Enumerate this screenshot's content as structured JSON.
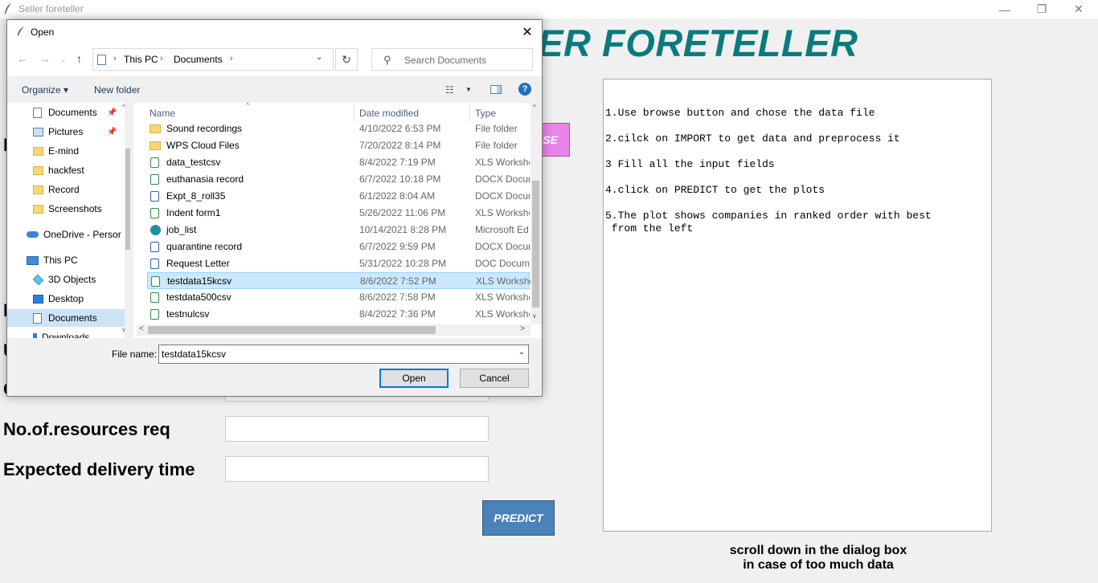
{
  "app": {
    "title": "Seller foreteller",
    "heading": "LER FORETELLER",
    "browse_label": "SE",
    "predict_label": "PREDICT",
    "window_buttons": {
      "minimize": "—",
      "maximize": "❐",
      "close": "✕"
    }
  },
  "form": {
    "partial_labels": [
      "I",
      "I",
      "U",
      "C"
    ],
    "labels": {
      "resources": "No.of.resources req",
      "delivery": "Expected delivery time"
    }
  },
  "instructions": [
    "1.Use browse button and chose the data file",
    "2.cilck on IMPORT to get data and preprocess it",
    "3 Fill all the input fields",
    "4.click on PREDICT to get the plots",
    "5.The plot shows companies in ranked order with best",
    " from the left"
  ],
  "note": [
    "scroll down in the dialog box",
    "in case of too much data"
  ],
  "dialog": {
    "title": "Open",
    "close_glyph": "✕",
    "nav": {
      "back": "←",
      "forward": "→",
      "recent": "⌄",
      "up": "↑",
      "refresh": "↻",
      "dropdown": "⌄"
    },
    "breadcrumb": [
      "This PC",
      "Documents"
    ],
    "breadcrumb_sep": "›",
    "search_placeholder": "Search Documents",
    "search_glyph": "⚲",
    "toolbar": {
      "organize": "Organize ▾",
      "new_folder": "New folder",
      "view_glyph": "☷",
      "view_dd": "▼",
      "help": "?"
    },
    "nav_pane": [
      {
        "label": "Documents",
        "icon": "doc",
        "pinned": true
      },
      {
        "label": "Pictures",
        "icon": "pic",
        "pinned": true
      },
      {
        "label": "E-mind",
        "icon": "folder",
        "pinned": false
      },
      {
        "label": "hackfest",
        "icon": "folder",
        "pinned": false
      },
      {
        "label": "Record",
        "icon": "folder",
        "pinned": false
      },
      {
        "label": "Screenshots",
        "icon": "folder",
        "pinned": false
      },
      {
        "label": "OneDrive - Persor",
        "icon": "cloud",
        "pinned": false
      },
      {
        "label": "This PC",
        "icon": "pc",
        "pinned": false
      },
      {
        "label": "3D Objects",
        "icon": "3d",
        "pinned": false
      },
      {
        "label": "Desktop",
        "icon": "desktop",
        "pinned": false
      },
      {
        "label": "Documents",
        "icon": "doc",
        "pinned": false,
        "selected": true
      },
      {
        "label": "Downloads",
        "icon": "dl",
        "pinned": false
      }
    ],
    "pin_glyph": "📌",
    "columns": {
      "name": "Name",
      "date": "Date modified",
      "type": "Type",
      "sort_glyph": "^"
    },
    "files": [
      {
        "name": "Sound recordings",
        "date": "4/10/2022 6:53 PM",
        "type": "File folder",
        "icon": "folder"
      },
      {
        "name": "WPS Cloud Files",
        "date": "7/20/2022 8:14 PM",
        "type": "File folder",
        "icon": "folder"
      },
      {
        "name": "data_testcsv",
        "date": "8/4/2022 7:19 PM",
        "type": "XLS Workshe",
        "icon": "xls"
      },
      {
        "name": "euthanasia record",
        "date": "6/7/2022 10:18 PM",
        "type": "DOCX Docur",
        "icon": "xls"
      },
      {
        "name": "Expt_8_roll35",
        "date": "6/1/2022 8:04 AM",
        "type": "DOCX Docur",
        "icon": "doc"
      },
      {
        "name": "Indent form1",
        "date": "5/26/2022 11:06 PM",
        "type": "XLS Workshe",
        "icon": "xls"
      },
      {
        "name": "job_list",
        "date": "10/14/2021 8:28 PM",
        "type": "Microsoft Ed",
        "icon": "edge"
      },
      {
        "name": "quarantine record",
        "date": "6/7/2022 9:59 PM",
        "type": "DOCX Docur",
        "icon": "doc"
      },
      {
        "name": "Request Letter",
        "date": "5/31/2022 10:28 PM",
        "type": "DOC Docum",
        "icon": "doc"
      },
      {
        "name": "testdata15kcsv",
        "date": "8/6/2022 7:52 PM",
        "type": "XLS Workshe",
        "icon": "xls",
        "selected": true
      },
      {
        "name": "testdata500csv",
        "date": "8/6/2022 7:58 PM",
        "type": "XLS Workshe",
        "icon": "xls"
      },
      {
        "name": "testnulcsv",
        "date": "8/4/2022 7:36 PM",
        "type": "XLS Workshe",
        "icon": "xls"
      }
    ],
    "scroll_glyphs": {
      "up": "^",
      "down": "v",
      "left": "<",
      "right": ">"
    },
    "file_name_label": "File name:",
    "file_name_value": "testdata15kcsv",
    "open_label": "Open",
    "cancel_label": "Cancel",
    "grip": "⋰"
  }
}
